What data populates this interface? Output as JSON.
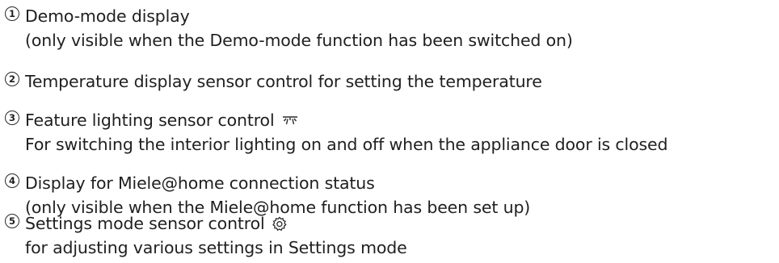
{
  "items": [
    {
      "number": "1",
      "title": "Demo-mode display",
      "detail": "(only visible when the Demo-mode function has been switched on)"
    },
    {
      "number": "2",
      "title": "Temperature display sensor control for setting the temperature"
    },
    {
      "number": "3",
      "title": "Feature lighting sensor control",
      "title_icon": "light-icon",
      "detail": "For switching the interior lighting on and off when the appliance door is closed"
    },
    {
      "number": "4",
      "title": "Display for Miele@home connection status",
      "detail": "(only visible when the Miele@home function has been set up)"
    },
    {
      "number": "5",
      "title": "Settings mode sensor control",
      "title_icon": "gear-icon",
      "detail": "for adjusting various settings in Settings mode"
    }
  ]
}
